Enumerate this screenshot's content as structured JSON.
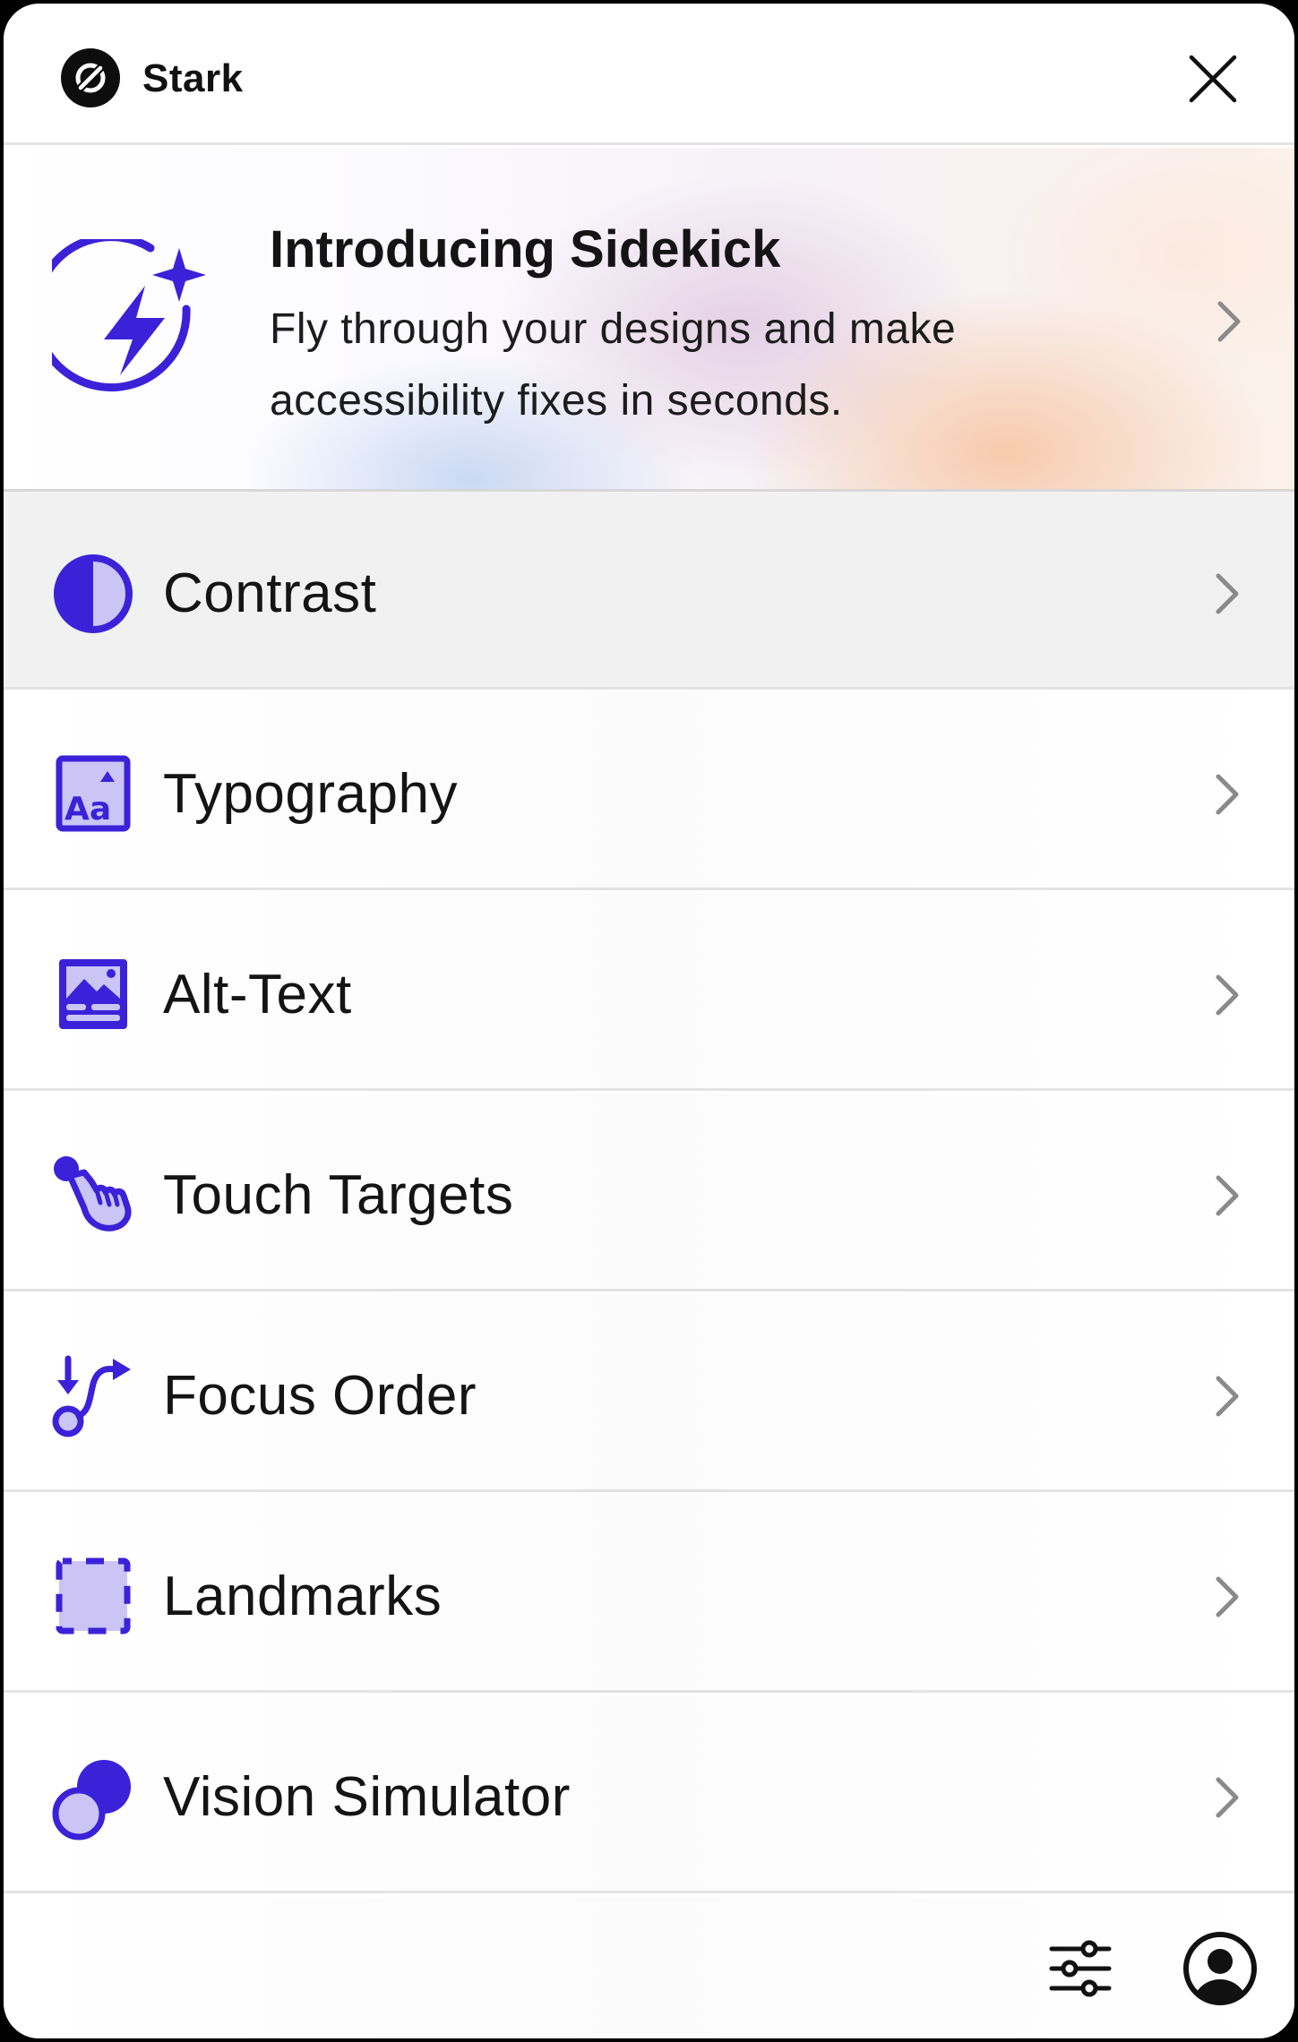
{
  "header": {
    "app_title": "Stark",
    "logo_icon": "stark-logo-icon",
    "close_icon": "close-icon"
  },
  "promo": {
    "title": "Introducing Sidekick",
    "description": "Fly through your designs and make accessibility fixes in seconds.",
    "icon": "sidekick-lightning-icon"
  },
  "menu": {
    "items": [
      {
        "label": "Contrast",
        "icon": "contrast-icon",
        "selected": true
      },
      {
        "label": "Typography",
        "icon": "typography-icon",
        "selected": false
      },
      {
        "label": "Alt-Text",
        "icon": "alt-text-icon",
        "selected": false
      },
      {
        "label": "Touch Targets",
        "icon": "touch-targets-icon",
        "selected": false
      },
      {
        "label": "Focus Order",
        "icon": "focus-order-icon",
        "selected": false
      },
      {
        "label": "Landmarks",
        "icon": "landmarks-icon",
        "selected": false
      },
      {
        "label": "Vision Simulator",
        "icon": "vision-simulator-icon",
        "selected": false
      }
    ]
  },
  "footer": {
    "settings_icon": "settings-sliders-icon",
    "account_icon": "account-icon"
  },
  "colors": {
    "accent": "#3b22d9",
    "accent_light": "#cbc4f4",
    "selected_row_bg": "#f1f1f2",
    "chevron": "#8a8a8a"
  }
}
